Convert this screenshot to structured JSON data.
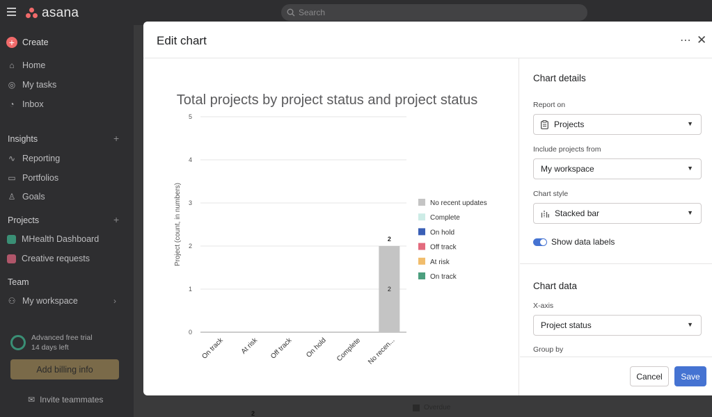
{
  "app": {
    "logo_text": "asana",
    "search_placeholder": "Search"
  },
  "sidebar": {
    "create_label": "Create",
    "nav": [
      {
        "label": "Home",
        "icon": "home-icon"
      },
      {
        "label": "My tasks",
        "icon": "check-circle-icon"
      },
      {
        "label": "Inbox",
        "icon": "bell-icon"
      }
    ],
    "insights": {
      "heading": "Insights",
      "items": [
        {
          "label": "Reporting",
          "icon": "chart-line-icon"
        },
        {
          "label": "Portfolios",
          "icon": "folder-icon"
        },
        {
          "label": "Goals",
          "icon": "person-icon"
        }
      ]
    },
    "projects": {
      "heading": "Projects",
      "items": [
        {
          "label": "MHealth Dashboard",
          "color": "#3a8f75"
        },
        {
          "label": "Creative requests",
          "color": "#b0566a"
        }
      ]
    },
    "team": {
      "heading": "Team",
      "item": "My workspace"
    },
    "trial": {
      "title": "Advanced free trial",
      "days": "14 days left"
    },
    "billing_label": "Add billing info",
    "invite_label": "Invite teammates"
  },
  "background": {
    "legend_overdue": "Overdue",
    "stray_value": "2"
  },
  "modal": {
    "title": "Edit chart",
    "more_label": "⋯",
    "close_label": "✕",
    "cancel_label": "Cancel",
    "save_label": "Save"
  },
  "details": {
    "heading": "Chart details",
    "report_on_label": "Report on",
    "report_on_value": "Projects",
    "include_label": "Include projects from",
    "include_value": "My workspace",
    "style_label": "Chart style",
    "style_value": "Stacked bar",
    "show_labels_label": "Show data labels",
    "show_labels_on": true,
    "chart_data_heading": "Chart data",
    "xaxis_label": "X-axis",
    "xaxis_value": "Project status",
    "groupby_label": "Group by"
  },
  "chart_data": {
    "type": "bar",
    "stacked": true,
    "title": "Total projects by project status and project status",
    "ylabel": "Project (count, in numbers)",
    "xlabel": "",
    "ylim": [
      0,
      5
    ],
    "yticks": [
      "0",
      "1",
      "2",
      "3",
      "4",
      "5"
    ],
    "categories": [
      "On track",
      "At risk",
      "Off track",
      "On hold",
      "Complete",
      "No recen..."
    ],
    "series": [
      {
        "name": "No recent updates",
        "color": "#c4c4c4",
        "values": [
          0,
          0,
          0,
          0,
          0,
          2
        ]
      },
      {
        "name": "Complete",
        "color": "#cdece6",
        "values": [
          0,
          0,
          0,
          0,
          0,
          0
        ]
      },
      {
        "name": "On hold",
        "color": "#3a5fb6",
        "values": [
          0,
          0,
          0,
          0,
          0,
          0
        ]
      },
      {
        "name": "Off track",
        "color": "#e36b7e",
        "values": [
          0,
          0,
          0,
          0,
          0,
          0
        ]
      },
      {
        "name": "At risk",
        "color": "#f1bd6c",
        "values": [
          0,
          0,
          0,
          0,
          0,
          0
        ]
      },
      {
        "name": "On track",
        "color": "#4c9f7e",
        "values": [
          0,
          0,
          0,
          0,
          0,
          0
        ]
      }
    ],
    "totals": [
      "",
      "",
      "",
      "",
      "",
      "2"
    ],
    "grid": true,
    "legend_position": "right"
  }
}
